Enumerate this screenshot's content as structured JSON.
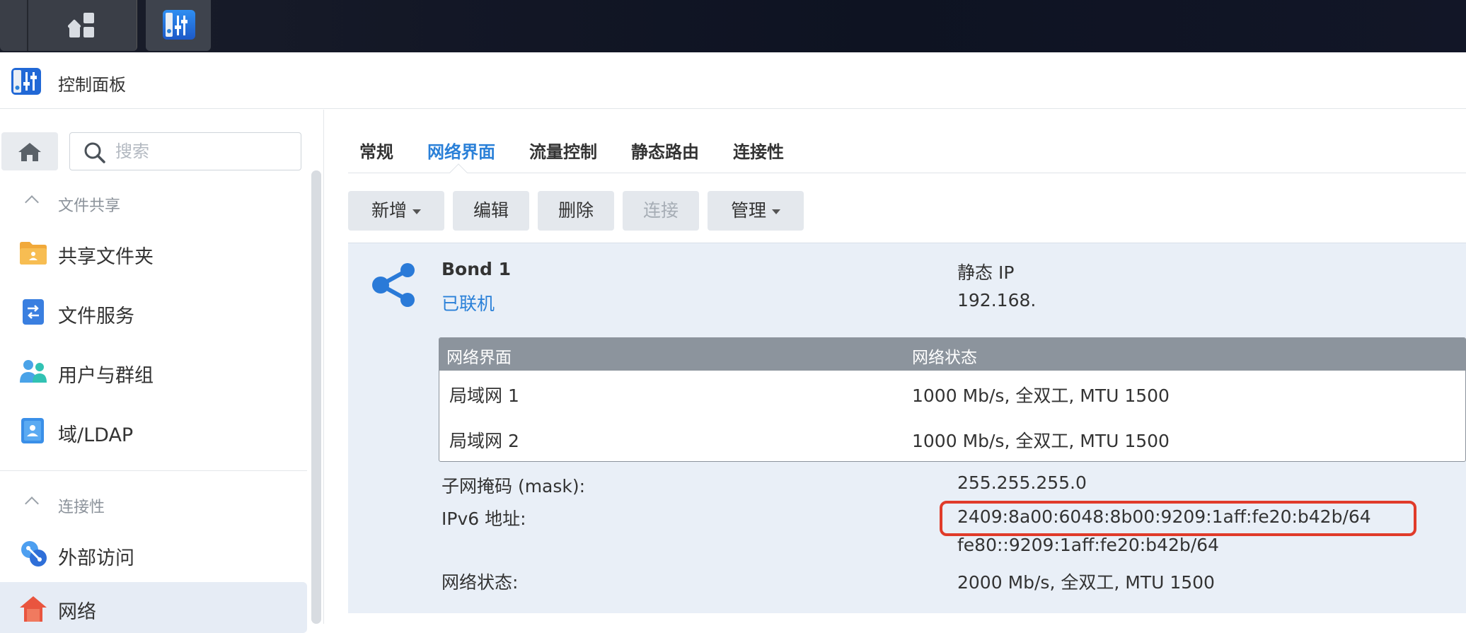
{
  "window": {
    "title": "控制面板"
  },
  "sidebar": {
    "search_placeholder": "搜索",
    "groups": [
      {
        "label": "文件共享"
      },
      {
        "label": "连接性"
      }
    ],
    "items": [
      {
        "label": "共享文件夹",
        "icon": "folder-icon"
      },
      {
        "label": "文件服务",
        "icon": "file-services-icon"
      },
      {
        "label": "用户与群组",
        "icon": "users-icon"
      },
      {
        "label": "域/LDAP",
        "icon": "domain-ldap-icon"
      },
      {
        "label": "外部访问",
        "icon": "external-access-icon"
      },
      {
        "label": "网络",
        "icon": "network-house-icon",
        "active": true
      }
    ]
  },
  "tabs": [
    {
      "label": "常规"
    },
    {
      "label": "网络界面",
      "active": true
    },
    {
      "label": "流量控制"
    },
    {
      "label": "静态路由"
    },
    {
      "label": "连接性"
    }
  ],
  "toolbar": {
    "create": "新增",
    "edit": "编辑",
    "delete": "删除",
    "connect": "连接",
    "manage": "管理"
  },
  "bond": {
    "name": "Bond 1",
    "status": "已联机",
    "ip_type": "静态 IP",
    "ip": "192.168.",
    "table": {
      "headers": [
        "网络界面",
        "网络状态"
      ],
      "rows": [
        {
          "iface": "局域网 1",
          "state": "1000 Mb/s, 全双工, MTU 1500"
        },
        {
          "iface": "局域网 2",
          "state": "1000 Mb/s, 全双工, MTU 1500"
        }
      ]
    },
    "mask_label": "子网掩码 (mask):",
    "mask_value": "255.255.255.0",
    "ipv6_label": "IPv6 地址:",
    "ipv6_value_1": "2409:8a00:6048:8b00:9209:1aff:fe20:b42b/64",
    "ipv6_value_2": "fe80::9209:1aff:fe20:b42b/64",
    "net_status_label": "网络状态:",
    "net_status_value": "2000 Mb/s, 全双工, MTU 1500"
  },
  "colors": {
    "accent": "#2a80d8",
    "highlight": "#e03b2a",
    "panel": "#e9eff7"
  }
}
